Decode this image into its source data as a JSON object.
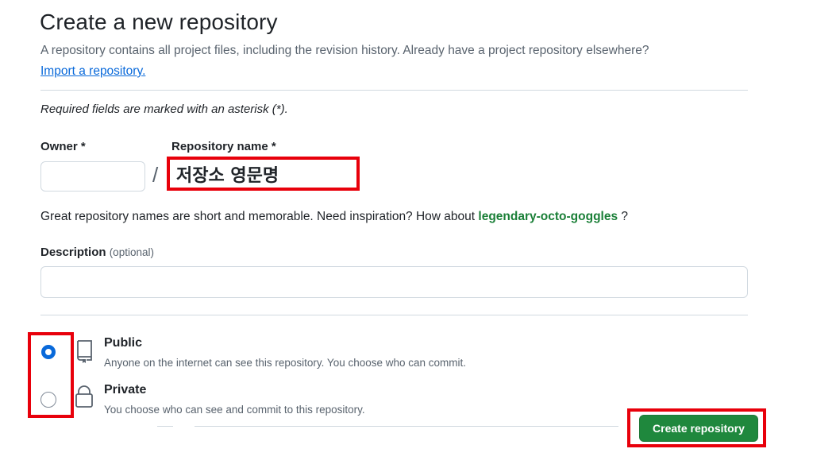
{
  "header": {
    "title": "Create a new repository",
    "subtitle": "A repository contains all project files, including the revision history. Already have a project repository elsewhere?",
    "import_link": "Import a repository."
  },
  "form": {
    "required_note": "Required fields are marked with an asterisk (*).",
    "owner_label": "Owner *",
    "owner_value": "",
    "separator": "/",
    "repo_label": "Repository name *",
    "repo_value": "저장소 영문명",
    "hint_text": "Great repository names are short and memorable. Need inspiration? How about",
    "suggestion": "legendary-octo-goggles",
    "hint_suffix": " ?",
    "description_label": "Description",
    "description_optional": "(optional)",
    "description_value": ""
  },
  "visibility": {
    "selected": "public",
    "options": [
      {
        "title": "Public",
        "description": "Anyone on the internet can see this repository. You choose who can commit.",
        "icon": "repo-icon"
      },
      {
        "title": "Private",
        "description": "You choose who can see and commit to this repository.",
        "icon": "lock-icon"
      }
    ]
  },
  "actions": {
    "create_label": "Create repository"
  },
  "colors": {
    "accent_blue": "#0969da",
    "success_green": "#1f883d",
    "highlight_red": "#e8000b"
  }
}
